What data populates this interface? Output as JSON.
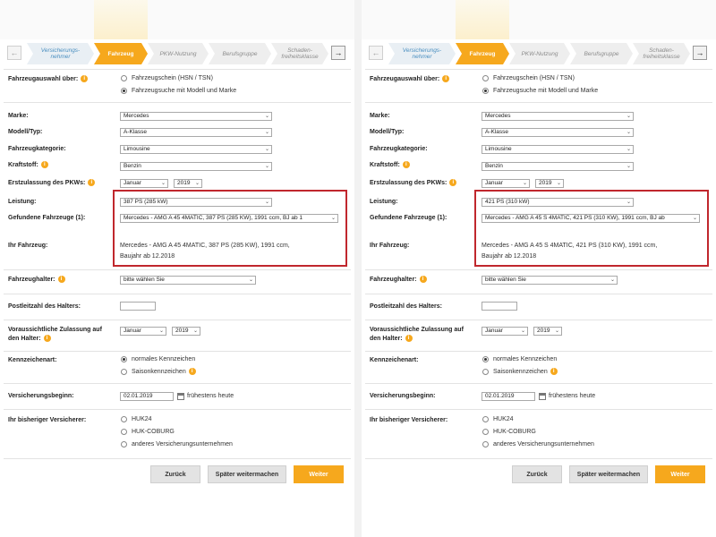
{
  "steps": [
    {
      "label": "Versicherungs-\nnehmer",
      "state": "done"
    },
    {
      "label": "Fahrzeug",
      "state": "active"
    },
    {
      "label": "PKW-Nutzung",
      "state": "todo"
    },
    {
      "label": "Berufsgruppe",
      "state": "todo"
    },
    {
      "label": "Schaden-\nfreiheitsklasse",
      "state": "todo"
    }
  ],
  "labels": {
    "fahrzeugauswahl": "Fahrzeugauswahl über:",
    "marke": "Marke:",
    "modell": "Modell/Typ:",
    "kategorie": "Fahrzeugkategorie:",
    "kraftstoff": "Kraftstoff:",
    "erstzulassung": "Erstzulassung des PKWs:",
    "leistung": "Leistung:",
    "gefunden": "Gefundene Fahrzeuge (1):",
    "ihr_fahrzeug": "Ihr Fahrzeug:",
    "halter": "Fahrzeughalter:",
    "plz": "Postleitzahl des Halters:",
    "zulassung_1": "Voraussichtliche Zulassung auf",
    "zulassung_2": "den Halter:",
    "kennzeichenart": "Kennzeichenart:",
    "beginn": "Versicherungsbeginn:",
    "versicherer": "Ihr bisheriger Versicherer:"
  },
  "options": {
    "auswahl_hsn": "Fahrzeugschein (HSN / TSN)",
    "auswahl_modell": "Fahrzeugsuche mit Modell und Marke",
    "kz_normal": "normales Kennzeichen",
    "kz_saison": "Saisonkennzeichen",
    "vers_huk24": "HUK24",
    "vers_coburg": "HUK-COBURG",
    "vers_andere": "anderes Versicherungsunternehmen"
  },
  "buttons": {
    "back": "Zurück",
    "later": "Später weitermachen",
    "next": "Weiter"
  },
  "panels": [
    {
      "marke": "Mercedes",
      "modell": "A-Klasse",
      "kategorie": "Limousine",
      "kraftstoff": "Benzin",
      "ez_monat": "Januar",
      "ez_jahr": "2019",
      "leistung": "387 PS (285 kW)",
      "gefunden": "Mercedes - AMG A 45 4MATIC, 387 PS (285 KW), 1991 ccm, BJ ab 1",
      "ihr_fahrzeug_1": "Mercedes - AMG A 45 4MATIC, 387 PS (285 KW), 1991 ccm,",
      "ihr_fahrzeug_2": "Baujahr ab 12.2018",
      "halter": "bitte wählen Sie",
      "plz": "",
      "zul_monat": "Januar",
      "zul_jahr": "2019",
      "beginn": "02.01.2019",
      "fruehestens": "frühestens heute"
    },
    {
      "marke": "Mercedes",
      "modell": "A-Klasse",
      "kategorie": "Limousine",
      "kraftstoff": "Benzin",
      "ez_monat": "Januar",
      "ez_jahr": "2019",
      "leistung": "421 PS (310 kW)",
      "gefunden": "Mercedes - AMG A 45 S 4MATIC, 421 PS (310 KW), 1991 ccm, BJ ab",
      "ihr_fahrzeug_1": "Mercedes - AMG A 45 S 4MATIC, 421 PS (310 KW), 1991 ccm,",
      "ihr_fahrzeug_2": "Baujahr ab 12.2018",
      "halter": "bitte wählen Sie",
      "plz": "",
      "zul_monat": "Januar",
      "zul_jahr": "2019",
      "beginn": "02.01.2019",
      "fruehestens": "frühestens heute"
    }
  ]
}
